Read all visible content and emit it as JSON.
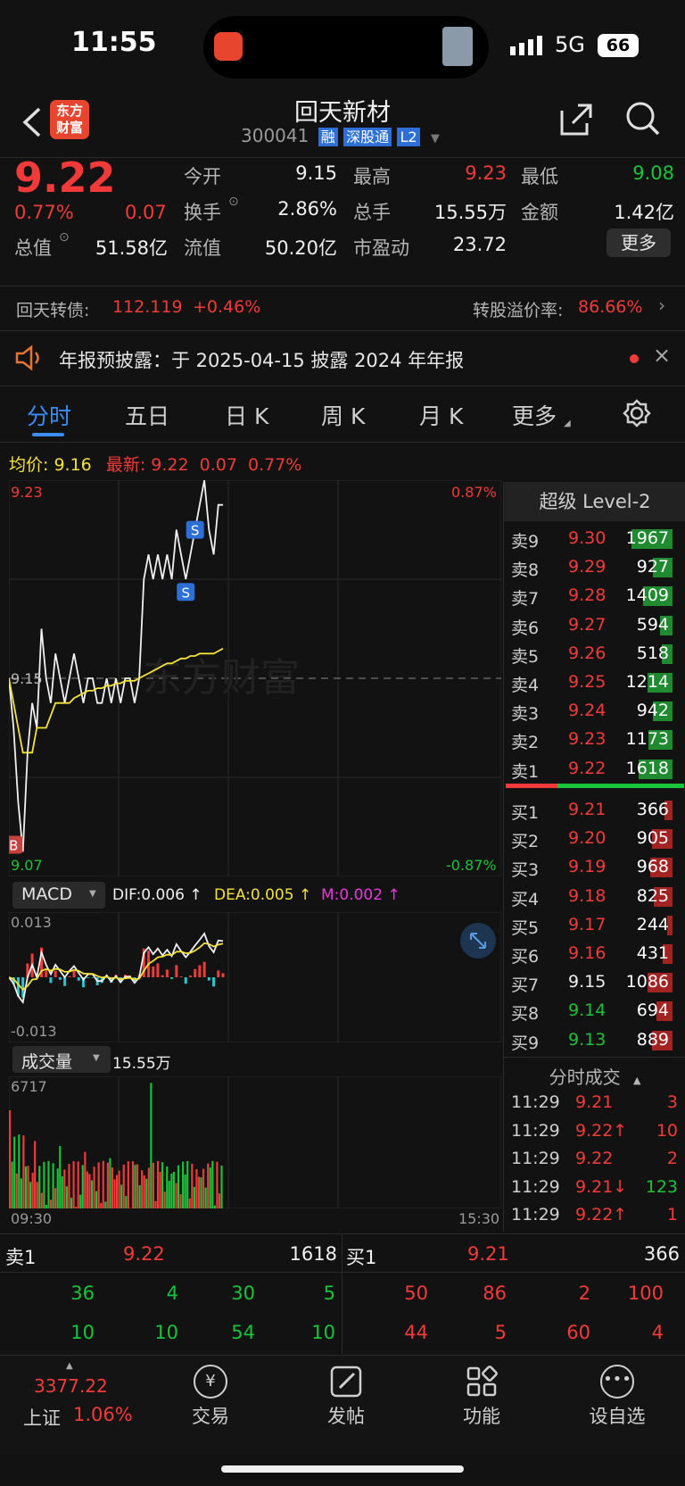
{
  "status_bar": {
    "time": "11:55",
    "network": "5G",
    "battery": "66"
  },
  "header": {
    "title": "回天新材",
    "code": "300041",
    "tags": [
      "融",
      "深股通",
      "L2"
    ],
    "logo_text": "东方财富"
  },
  "quote": {
    "price": "9.22",
    "pct": "0.77%",
    "change": "0.07",
    "rows": [
      {
        "label": "今开",
        "value": "9.15",
        "label2": "最高",
        "value2": "9.23",
        "label3": "最低",
        "value3": "9.08"
      },
      {
        "label": "换手",
        "value": "2.86%",
        "label2": "总手",
        "value2": "15.55万",
        "label3": "金额",
        "value3": "1.42亿"
      },
      {
        "label": "总值",
        "value": "51.58亿",
        "label2": "流值",
        "value2": "50.20亿",
        "label3": "市盈动",
        "value3": "23.72"
      }
    ],
    "more_button": "更多"
  },
  "bond": {
    "label": "回天转债:",
    "value": "112.119",
    "change": "+0.46%",
    "premium_label": "转股溢价率:",
    "premium": "86.66%"
  },
  "notice": {
    "text": "年报预披露：于 2025-04-15 披露 2024 年年报"
  },
  "tabs": [
    "分时",
    "五日",
    "日 K",
    "周 K",
    "月 K",
    "更多"
  ],
  "chart_header": {
    "avg_label": "均价:",
    "avg": "9.16",
    "last_label": "最新:",
    "last": "9.22",
    "chg": "0.07",
    "pct": "0.77%"
  },
  "chart_data": {
    "type": "line",
    "title": "",
    "y_top": "9.23",
    "y_mid": "9.15",
    "y_bottom": "9.07",
    "pct_top": "0.87%",
    "pct_bottom": "-0.87%",
    "x_start": "09:30",
    "x_end": "15:30",
    "ylim": [
      9.07,
      9.23
    ],
    "price": [
      9.15,
      9.13,
      9.1,
      9.08,
      9.12,
      9.14,
      9.13,
      9.17,
      9.15,
      9.14,
      9.16,
      9.15,
      9.14,
      9.15,
      9.16,
      9.15,
      9.14,
      9.15,
      9.15,
      9.14,
      9.14,
      9.15,
      9.14,
      9.15,
      9.14,
      9.15,
      9.15,
      9.14,
      9.15,
      9.19,
      9.2,
      9.19,
      9.2,
      9.19,
      9.2,
      9.19,
      9.21,
      9.2,
      9.19,
      9.2,
      9.21,
      9.22,
      9.23,
      9.21,
      9.2,
      9.22,
      9.22
    ],
    "avg": [
      9.15,
      9.14,
      9.13,
      9.12,
      9.12,
      9.12,
      9.13,
      9.13,
      9.13,
      9.135,
      9.14,
      9.14,
      9.14,
      9.14,
      9.142,
      9.143,
      9.144,
      9.145,
      9.145,
      9.146,
      9.146,
      9.147,
      9.147,
      9.148,
      9.148,
      9.149,
      9.149,
      9.149,
      9.15,
      9.151,
      9.152,
      9.153,
      9.154,
      9.155,
      9.156,
      9.156,
      9.157,
      9.158,
      9.158,
      9.159,
      9.159,
      9.16,
      9.16,
      9.16,
      9.16,
      9.161,
      9.162
    ],
    "signals": [
      {
        "type": "B"
      },
      {
        "type": "S"
      },
      {
        "type": "S"
      }
    ]
  },
  "macd": {
    "name": "MACD",
    "dif": "DIF:0.006 ↑",
    "dea": "DEA:0.005 ↑",
    "m": "M:0.002 ↑",
    "top": "0.013",
    "bottom": "-0.013"
  },
  "volume": {
    "name": "成交量",
    "value": "15.55万",
    "max": "6717"
  },
  "orderbook": {
    "title": "超级 Level-2",
    "asks": [
      {
        "label": "卖9",
        "price": "9.30",
        "vol": "1967"
      },
      {
        "label": "卖8",
        "price": "9.29",
        "vol": "927"
      },
      {
        "label": "卖7",
        "price": "9.28",
        "vol": "1409"
      },
      {
        "label": "卖6",
        "price": "9.27",
        "vol": "594"
      },
      {
        "label": "卖5",
        "price": "9.26",
        "vol": "518"
      },
      {
        "label": "卖4",
        "price": "9.25",
        "vol": "1214"
      },
      {
        "label": "卖3",
        "price": "9.24",
        "vol": "942"
      },
      {
        "label": "卖2",
        "price": "9.23",
        "vol": "1173"
      },
      {
        "label": "卖1",
        "price": "9.22",
        "vol": "1618"
      }
    ],
    "bids": [
      {
        "label": "买1",
        "price": "9.21",
        "vol": "366"
      },
      {
        "label": "买2",
        "price": "9.20",
        "vol": "905"
      },
      {
        "label": "买3",
        "price": "9.19",
        "vol": "968"
      },
      {
        "label": "买4",
        "price": "9.18",
        "vol": "825"
      },
      {
        "label": "买5",
        "price": "9.17",
        "vol": "244"
      },
      {
        "label": "买6",
        "price": "9.16",
        "vol": "431"
      },
      {
        "label": "买7",
        "price": "9.15",
        "vol": "1086"
      },
      {
        "label": "买8",
        "price": "9.14",
        "vol": "694"
      },
      {
        "label": "买9",
        "price": "9.13",
        "vol": "889"
      }
    ]
  },
  "ticks": {
    "title": "分时成交",
    "rows": [
      {
        "time": "11:29",
        "price": "9.21",
        "vol": "3"
      },
      {
        "time": "11:29",
        "price": "9.22↑",
        "vol": "10"
      },
      {
        "time": "11:29",
        "price": "9.22",
        "vol": "2"
      },
      {
        "time": "11:29",
        "price": "9.21↓",
        "vol": "123"
      },
      {
        "time": "11:29",
        "price": "9.22↑",
        "vol": "1"
      }
    ]
  },
  "queue": {
    "ask_label": "卖1",
    "ask_price": "9.22",
    "ask_vol": "1618",
    "bid_label": "买1",
    "bid_price": "9.21",
    "bid_vol": "366",
    "ask_rows": [
      [
        "36",
        "4",
        "30",
        "5"
      ],
      [
        "10",
        "10",
        "54",
        "10"
      ]
    ],
    "bid_rows": [
      [
        "50",
        "86",
        "2",
        "100"
      ],
      [
        "44",
        "5",
        "60",
        "4"
      ]
    ]
  },
  "bottom_nav": {
    "index_value": "3377.22",
    "index_name": "上证",
    "index_pct": "1.06%",
    "items": [
      "交易",
      "发帖",
      "功能",
      "设自选"
    ]
  }
}
